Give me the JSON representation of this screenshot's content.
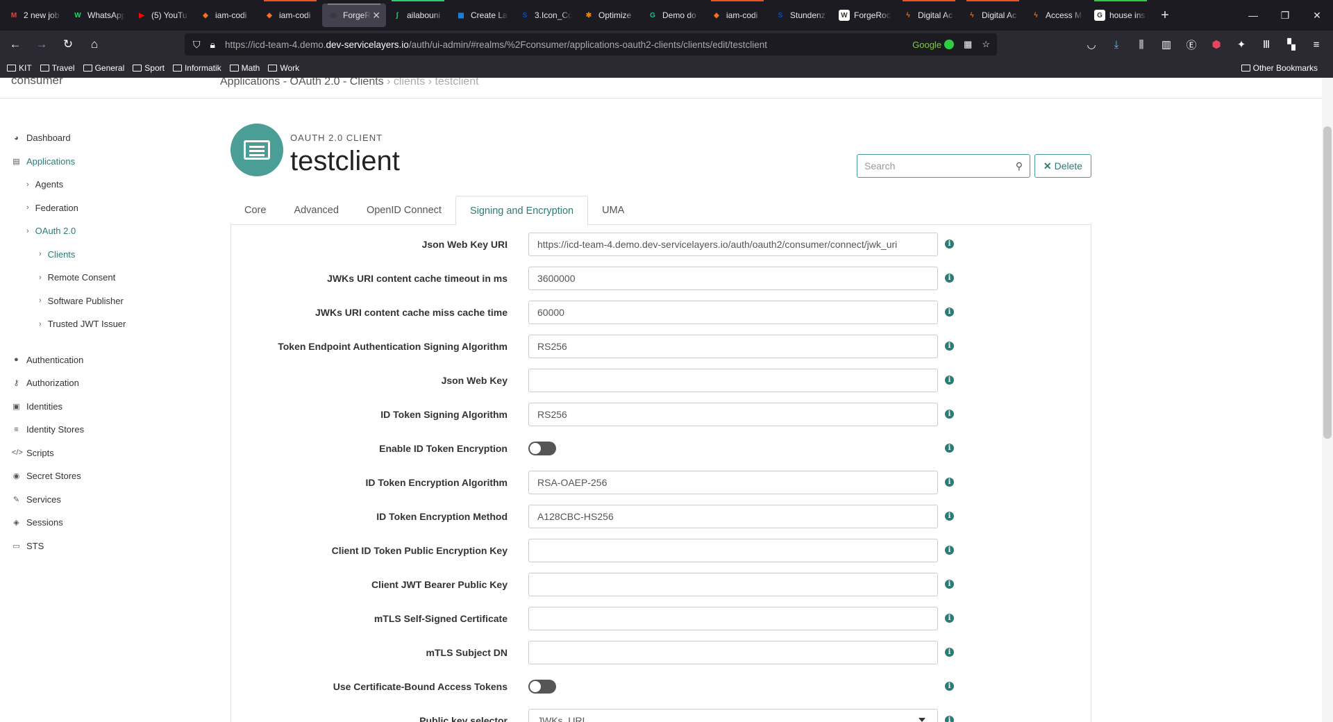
{
  "browser": {
    "tabs": [
      {
        "title": "2 new job",
        "icon": "gmail-icon",
        "color": "#ea4335",
        "glyph": "M",
        "accent": ""
      },
      {
        "title": "WhatsApp",
        "icon": "whatsapp-icon",
        "color": "#25d366",
        "glyph": "W",
        "accent": ""
      },
      {
        "title": "(5) YouTu",
        "icon": "youtube-icon",
        "color": "#ff0000",
        "glyph": "▶",
        "accent": ""
      },
      {
        "title": "iam-codi",
        "icon": "gitlab-icon",
        "color": "#fc6d26",
        "glyph": "◆",
        "accent": ""
      },
      {
        "title": "iam-codi",
        "icon": "gitlab-icon",
        "color": "#fc6d26",
        "glyph": "◆",
        "accent": "#e95420"
      },
      {
        "title": "ForgeR",
        "icon": "forgerock-icon",
        "color": "#333",
        "glyph": "◎",
        "accent": "#7f7f7f",
        "active": true
      },
      {
        "title": "ailabouni",
        "icon": "git-icon",
        "color": "#2ecc71",
        "glyph": "ʃ",
        "accent": "#2ecc71"
      },
      {
        "title": "Create La",
        "icon": "windows-icon",
        "color": "#1e88e5",
        "glyph": "▦",
        "accent": ""
      },
      {
        "title": "3.Icon_Co",
        "icon": "confluence-icon",
        "color": "#0052cc",
        "glyph": "S",
        "accent": ""
      },
      {
        "title": "Optimize",
        "icon": "gear-icon",
        "color": "#ff9800",
        "glyph": "✻",
        "accent": ""
      },
      {
        "title": "Demo do",
        "icon": "grammarly-icon",
        "color": "#15c39a",
        "glyph": "G",
        "accent": ""
      },
      {
        "title": "iam-codi",
        "icon": "gitlab-icon",
        "color": "#fc6d26",
        "glyph": "◆",
        "accent": "#e95420"
      },
      {
        "title": "Stundenz",
        "icon": "confluence-icon",
        "color": "#0052cc",
        "glyph": "S",
        "accent": ""
      },
      {
        "title": "ForgeRoc",
        "icon": "wikipedia-icon",
        "color": "#ffffff",
        "glyph": "W",
        "accent": ""
      },
      {
        "title": "Digital Ac",
        "icon": "bolt-icon",
        "color": "#ff6a00",
        "glyph": "ϟ",
        "accent": "#e95420"
      },
      {
        "title": "Digital Ac",
        "icon": "bolt-icon",
        "color": "#ff6a00",
        "glyph": "ϟ",
        "accent": "#e95420"
      },
      {
        "title": "Access M",
        "icon": "bolt-icon",
        "color": "#ff6a00",
        "glyph": "ϟ",
        "accent": ""
      },
      {
        "title": "house ins",
        "icon": "google-icon",
        "color": "#ffffff",
        "glyph": "G",
        "accent": "#2ecc40"
      }
    ],
    "url_prefix": "https://icd-team-4.demo.",
    "url_domain": "dev-servicelayers.io",
    "url_path": "/auth/ui-admin/#realms/%2Fconsumer/applications-oauth2-clients/clients/edit/testclient",
    "search_engine": "Google",
    "bookmarks": [
      "KIT",
      "Travel",
      "General",
      "Sport",
      "Informatik",
      "Math",
      "Work"
    ],
    "other_bookmarks": "Other Bookmarks"
  },
  "app": {
    "realm": "consumer",
    "breadcrumb": {
      "part1": "Applications - OAuth 2.0 - Clients",
      "part2": "› clients › testclient"
    },
    "sidebar": [
      {
        "label": "Dashboard",
        "icon": "dashboard-icon",
        "glyph": "◕",
        "level": 0
      },
      {
        "label": "Applications",
        "icon": "applications-icon",
        "glyph": "▤",
        "level": 0,
        "active": true
      },
      {
        "label": "Agents",
        "level": 1
      },
      {
        "label": "Federation",
        "level": 1
      },
      {
        "label": "OAuth 2.0",
        "level": 1,
        "active": true
      },
      {
        "label": "Clients",
        "level": 2,
        "active": true
      },
      {
        "label": "Remote Consent",
        "level": 2
      },
      {
        "label": "Software Publisher",
        "level": 2
      },
      {
        "label": "Trusted JWT Issuer",
        "level": 2
      },
      {
        "gap": true
      },
      {
        "label": "Authentication",
        "icon": "user-icon",
        "glyph": "●",
        "level": 0
      },
      {
        "label": "Authorization",
        "icon": "key-icon",
        "glyph": "⚷",
        "level": 0
      },
      {
        "label": "Identities",
        "icon": "id-card-icon",
        "glyph": "▣",
        "level": 0
      },
      {
        "label": "Identity Stores",
        "icon": "database-icon",
        "glyph": "≡",
        "level": 0
      },
      {
        "label": "Scripts",
        "icon": "code-icon",
        "glyph": "</>",
        "level": 0
      },
      {
        "label": "Secret Stores",
        "icon": "eye-slash-icon",
        "glyph": "◉",
        "level": 0
      },
      {
        "label": "Services",
        "icon": "plug-icon",
        "glyph": "✎",
        "level": 0
      },
      {
        "label": "Sessions",
        "icon": "tag-icon",
        "glyph": "◈",
        "level": 0
      },
      {
        "label": "STS",
        "icon": "credit-card-icon",
        "glyph": "▭",
        "level": 0
      }
    ],
    "header": {
      "type": "OAUTH 2.0 CLIENT",
      "name": "testclient"
    },
    "search_placeholder": "Search",
    "delete_label": "Delete",
    "tabs": [
      {
        "label": "Core"
      },
      {
        "label": "Advanced"
      },
      {
        "label": "OpenID Connect"
      },
      {
        "label": "Signing and Encryption",
        "active": true
      },
      {
        "label": "UMA"
      }
    ],
    "fields": [
      {
        "label": "Json Web Key URI",
        "type": "text",
        "value": "https://icd-team-4.demo.dev-servicelayers.io/auth/oauth2/consumer/connect/jwk_uri"
      },
      {
        "label": "JWKs URI content cache timeout in ms",
        "type": "text",
        "value": "3600000"
      },
      {
        "label": "JWKs URI content cache miss cache time",
        "type": "text",
        "value": "60000"
      },
      {
        "label": "Token Endpoint Authentication Signing Algorithm",
        "type": "text",
        "value": "RS256"
      },
      {
        "label": "Json Web Key",
        "type": "text",
        "value": ""
      },
      {
        "label": "ID Token Signing Algorithm",
        "type": "text",
        "value": "RS256"
      },
      {
        "label": "Enable ID Token Encryption",
        "type": "toggle",
        "value": "off"
      },
      {
        "label": "ID Token Encryption Algorithm",
        "type": "text",
        "value": "RSA-OAEP-256"
      },
      {
        "label": "ID Token Encryption Method",
        "type": "text",
        "value": "A128CBC-HS256"
      },
      {
        "label": "Client ID Token Public Encryption Key",
        "type": "text",
        "value": ""
      },
      {
        "label": "Client JWT Bearer Public Key",
        "type": "text",
        "value": ""
      },
      {
        "label": "mTLS Self-Signed Certificate",
        "type": "text",
        "value": ""
      },
      {
        "label": "mTLS Subject DN",
        "type": "text",
        "value": ""
      },
      {
        "label": "Use Certificate-Bound Access Tokens",
        "type": "toggle",
        "value": "off"
      },
      {
        "label": "Public key selector",
        "type": "select",
        "value": "JWKs_URI"
      }
    ],
    "colors": {
      "accent": "#2c7b74",
      "icon_bg": "#4a9e95"
    }
  }
}
